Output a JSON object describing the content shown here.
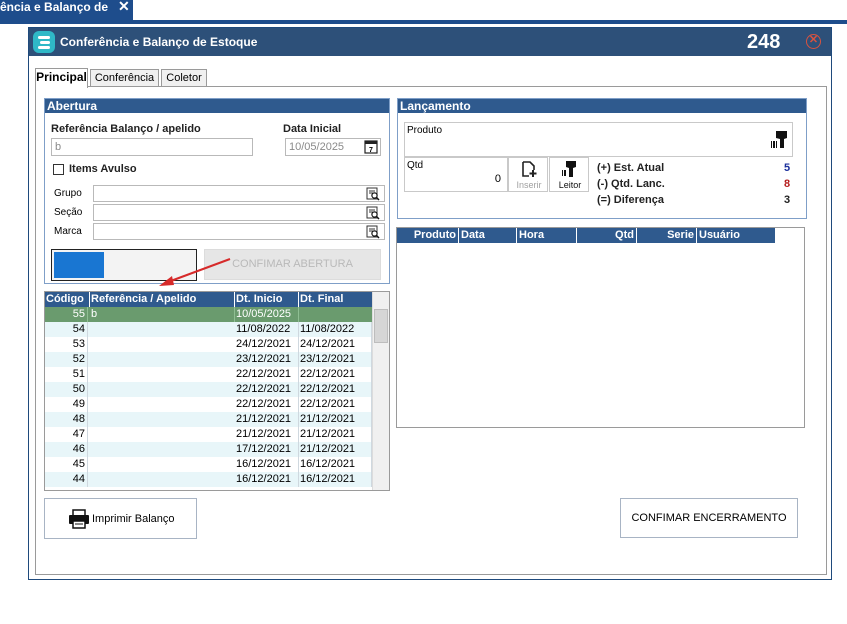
{
  "outer_tab": {
    "label": "ência e Balanço de",
    "close": "✕"
  },
  "window": {
    "title": "Conferência e Balanço de Estoque",
    "number": "248",
    "close": "✕"
  },
  "tabs": [
    "Principal",
    "Conferência",
    "Coletor"
  ],
  "abertura": {
    "header": "Abertura",
    "ref_label": "Referência Balanço / apelido",
    "ref_value": "b",
    "data_label": "Data Inicial",
    "data_value": "10/05/2025",
    "items_avulso_label": "Items Avulso",
    "items_avulso_checked": false,
    "grupo_label": "Grupo",
    "secao_label": "Seção",
    "marca_label": "Marca",
    "confirm_label": "CONFIMAR ABERTURA"
  },
  "lancamento": {
    "header": "Lançamento",
    "produto_label": "Produto",
    "qtd_label": "Qtd",
    "qtd_value": "0",
    "inserir_label": "Inserir",
    "leitor_label": "Leitor",
    "est_atual_label": "(+) Est. Atual",
    "est_atual_value": "5",
    "qtd_lanc_label": "(-) Qtd. Lanc.",
    "qtd_lanc_value": "8",
    "diferenca_label": "(=) Diferença",
    "diferenca_value": "3",
    "value_colors": {
      "est_atual": "#1a2f9c",
      "qtd_lanc": "#b51d1d",
      "diferenca": "#000000"
    }
  },
  "lanc_grid": {
    "columns": [
      "Produto",
      "Data",
      "Hora",
      "Qtd",
      "Serie",
      "Usuário"
    ]
  },
  "balanco_grid": {
    "columns": [
      "Código",
      "Referência / Apelido",
      "Dt. Inicio",
      "Dt. Final"
    ],
    "rows": [
      [
        "55",
        "b",
        "10/05/2025",
        ""
      ],
      [
        "54",
        "",
        "11/08/2022",
        "11/08/2022"
      ],
      [
        "53",
        "",
        "24/12/2021",
        "24/12/2021"
      ],
      [
        "52",
        "",
        "23/12/2021",
        "23/12/2021"
      ],
      [
        "51",
        "",
        "22/12/2021",
        "22/12/2021"
      ],
      [
        "50",
        "",
        "22/12/2021",
        "22/12/2021"
      ],
      [
        "49",
        "",
        "22/12/2021",
        "22/12/2021"
      ],
      [
        "48",
        "",
        "21/12/2021",
        "21/12/2021"
      ],
      [
        "47",
        "",
        "21/12/2021",
        "21/12/2021"
      ],
      [
        "46",
        "",
        "17/12/2021",
        "21/12/2021"
      ],
      [
        "45",
        "",
        "16/12/2021",
        "16/12/2021"
      ],
      [
        "44",
        "",
        "16/12/2021",
        "16/12/2021"
      ]
    ]
  },
  "footer": {
    "print_label": "Imprimir Balanço",
    "close_label": "CONFIMAR ENCERRAMENTO"
  },
  "colors": {
    "header_blue": "#2f5a8e",
    "title_bar": "#2d5079",
    "selected_row": "#6a9b6e",
    "progress_blue": "#1976d2",
    "arrow_red": "#d62a2a"
  }
}
